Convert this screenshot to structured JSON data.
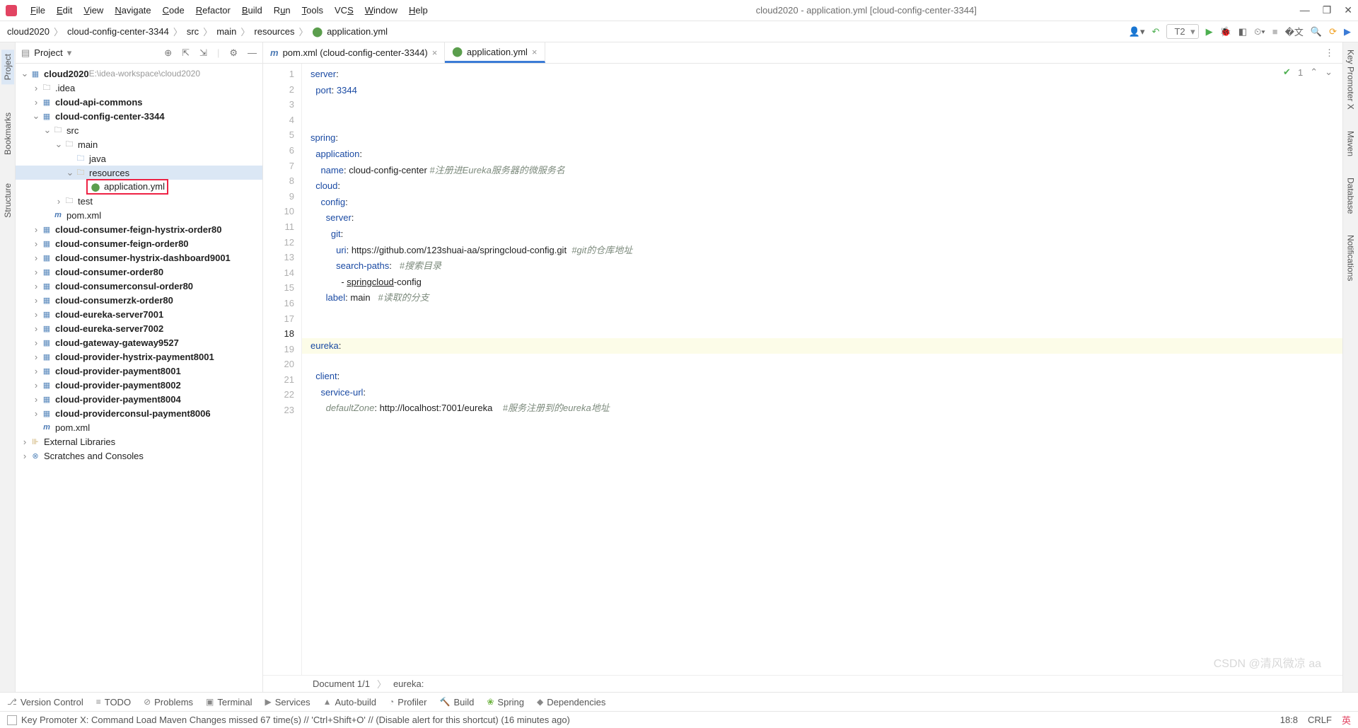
{
  "window": {
    "title": "cloud2020 - application.yml [cloud-config-center-3344]"
  },
  "menu": [
    "File",
    "Edit",
    "View",
    "Navigate",
    "Code",
    "Refactor",
    "Build",
    "Run",
    "Tools",
    "VCS",
    "Window",
    "Help"
  ],
  "breadcrumb": [
    "cloud2020",
    "cloud-config-center-3344",
    "src",
    "main",
    "resources",
    "application.yml"
  ],
  "runConfig": "T2",
  "projectPane": {
    "title": "Project",
    "rootHint": "E:\\idea-workspace\\cloud2020"
  },
  "tree": [
    {
      "d": 0,
      "exp": "v",
      "ic": "module",
      "txt": "cloud2020",
      "bold": true,
      "hint": "E:\\idea-workspace\\cloud2020"
    },
    {
      "d": 1,
      "exp": ">",
      "ic": "folder",
      "txt": ".idea"
    },
    {
      "d": 1,
      "exp": ">",
      "ic": "module",
      "txt": "cloud-api-commons",
      "bold": true
    },
    {
      "d": 1,
      "exp": "v",
      "ic": "module",
      "txt": "cloud-config-center-3344",
      "bold": true
    },
    {
      "d": 2,
      "exp": "v",
      "ic": "folder",
      "txt": "src"
    },
    {
      "d": 3,
      "exp": "v",
      "ic": "folder",
      "txt": "main"
    },
    {
      "d": 4,
      "exp": "",
      "ic": "folder-blue",
      "txt": "java"
    },
    {
      "d": 4,
      "exp": "v",
      "ic": "folder-res",
      "txt": "resources",
      "sel": true
    },
    {
      "d": 5,
      "exp": "",
      "ic": "yaml",
      "txt": "application.yml",
      "hl": true
    },
    {
      "d": 3,
      "exp": ">",
      "ic": "folder",
      "txt": "test"
    },
    {
      "d": 2,
      "exp": "",
      "ic": "maven",
      "txt": "pom.xml"
    },
    {
      "d": 1,
      "exp": ">",
      "ic": "module",
      "txt": "cloud-consumer-feign-hystrix-order80",
      "bold": true
    },
    {
      "d": 1,
      "exp": ">",
      "ic": "module",
      "txt": "cloud-consumer-feign-order80",
      "bold": true
    },
    {
      "d": 1,
      "exp": ">",
      "ic": "module",
      "txt": "cloud-consumer-hystrix-dashboard9001",
      "bold": true
    },
    {
      "d": 1,
      "exp": ">",
      "ic": "module",
      "txt": "cloud-consumer-order80",
      "bold": true
    },
    {
      "d": 1,
      "exp": ">",
      "ic": "module",
      "txt": "cloud-consumerconsul-order80",
      "bold": true
    },
    {
      "d": 1,
      "exp": ">",
      "ic": "module",
      "txt": "cloud-consumerzk-order80",
      "bold": true
    },
    {
      "d": 1,
      "exp": ">",
      "ic": "module",
      "txt": "cloud-eureka-server7001",
      "bold": true
    },
    {
      "d": 1,
      "exp": ">",
      "ic": "module",
      "txt": "cloud-eureka-server7002",
      "bold": true
    },
    {
      "d": 1,
      "exp": ">",
      "ic": "module",
      "txt": "cloud-gateway-gateway9527",
      "bold": true
    },
    {
      "d": 1,
      "exp": ">",
      "ic": "module",
      "txt": "cloud-provider-hystrix-payment8001",
      "bold": true
    },
    {
      "d": 1,
      "exp": ">",
      "ic": "module",
      "txt": "cloud-provider-payment8001",
      "bold": true
    },
    {
      "d": 1,
      "exp": ">",
      "ic": "module",
      "txt": "cloud-provider-payment8002",
      "bold": true
    },
    {
      "d": 1,
      "exp": ">",
      "ic": "module",
      "txt": "cloud-provider-payment8004",
      "bold": true
    },
    {
      "d": 1,
      "exp": ">",
      "ic": "module",
      "txt": "cloud-providerconsul-payment8006",
      "bold": true
    },
    {
      "d": 1,
      "exp": "",
      "ic": "maven",
      "txt": "pom.xml"
    },
    {
      "d": 0,
      "exp": ">",
      "ic": "lib",
      "txt": "External Libraries"
    },
    {
      "d": 0,
      "exp": ">",
      "ic": "scratch",
      "txt": "Scratches and Consoles"
    }
  ],
  "tabs": [
    {
      "ic": "maven",
      "label": "pom.xml (cloud-config-center-3344)",
      "active": false
    },
    {
      "ic": "yaml",
      "label": "application.yml",
      "active": true
    }
  ],
  "inspection": {
    "count": "1"
  },
  "code": {
    "lines": 23,
    "currentLine": 18
  },
  "codeText": {
    "l1_k": "server",
    "l1_p": ":",
    "l2_k": "port",
    "l2_p": ": ",
    "l2_v": "3344",
    "l5_k": "spring",
    "l5_p": ":",
    "l6_k": "application",
    "l6_p": ":",
    "l7_k": "name",
    "l7_p": ": ",
    "l7_v": "cloud-config-center ",
    "l7_c": "#注册进Eureka服务器的微服务名",
    "l8_k": "cloud",
    "l8_p": ":",
    "l9_k": "config",
    "l9_p": ":",
    "l10_k": "server",
    "l10_p": ":",
    "l11_k": "git",
    "l11_p": ":",
    "l12_k": "uri",
    "l12_p": ": ",
    "l12_v": "https://github.com/123shuai-aa/springcloud-config.git  ",
    "l12_c": "#git的仓库地址",
    "l13_k": "search-paths",
    "l13_p": ":   ",
    "l13_c": "#搜索目录",
    "l14_p": "- ",
    "l14_v": "springcloud",
    "l14_v2": "-config",
    "l15_k": "label",
    "l15_p": ": ",
    "l15_v": "main   ",
    "l15_c": "#读取的分支",
    "l18_k": "eureka",
    "l18_p": ":",
    "l19_k": "client",
    "l19_p": ":",
    "l20_k": "service-url",
    "l20_p": ":",
    "l21_k": "defaultZone",
    "l21_p": ": ",
    "l21_v": "http://localhost:7001/eureka    ",
    "l21_c": "#服务注册到的eureka地址"
  },
  "crumbBar": {
    "doc": "Document 1/1",
    "path": "eureka:"
  },
  "leftRail": [
    "Project",
    "Bookmarks",
    "Structure"
  ],
  "rightRail": [
    "Key Promoter X",
    "Maven",
    "Database",
    "Notifications"
  ],
  "bottomTools": [
    "Version Control",
    "TODO",
    "Problems",
    "Terminal",
    "Services",
    "Auto-build",
    "Profiler",
    "Build",
    "Spring",
    "Dependencies"
  ],
  "status": {
    "msg": "Key Promoter X: Command Load Maven Changes missed 67 time(s) // 'Ctrl+Shift+O' // (Disable alert for this shortcut) (16 minutes ago)",
    "pos": "18:8",
    "enc": "CRLF"
  },
  "watermark": "CSDN @清风微凉 aa"
}
